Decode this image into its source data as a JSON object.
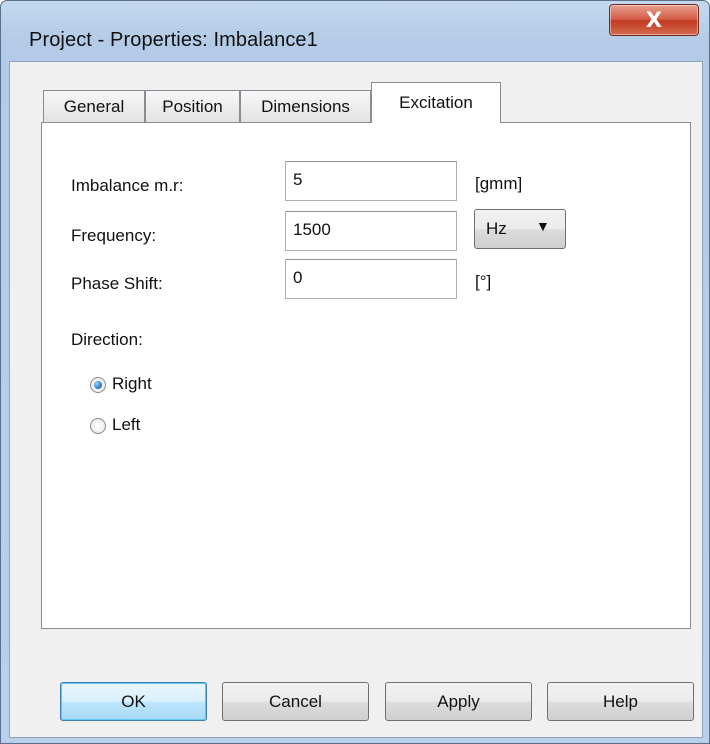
{
  "window": {
    "title": "Project - Properties: Imbalance1",
    "close_glyph": "X"
  },
  "tabs": [
    {
      "label": "General"
    },
    {
      "label": "Position"
    },
    {
      "label": "Dimensions"
    },
    {
      "label": "Excitation",
      "active": true
    }
  ],
  "excitation": {
    "imbalance": {
      "label": "Imbalance m.r:",
      "value": "5",
      "unit": "[gmm]"
    },
    "frequency": {
      "label": "Frequency:",
      "value": "1500",
      "unit_selected": "Hz",
      "arrow": "▼"
    },
    "phase": {
      "label": "Phase Shift:",
      "value": "0",
      "unit": "[°]"
    },
    "direction": {
      "label": "Direction:",
      "options": [
        {
          "label": "Right",
          "checked": true
        },
        {
          "label": "Left",
          "checked": false
        }
      ]
    }
  },
  "buttons": {
    "ok": "OK",
    "cancel": "Cancel",
    "apply": "Apply",
    "help": "Help"
  },
  "colors": {
    "close_button": "#c94a33",
    "default_button_border": "#3c7fb1",
    "frame": "#b9d0ea"
  }
}
